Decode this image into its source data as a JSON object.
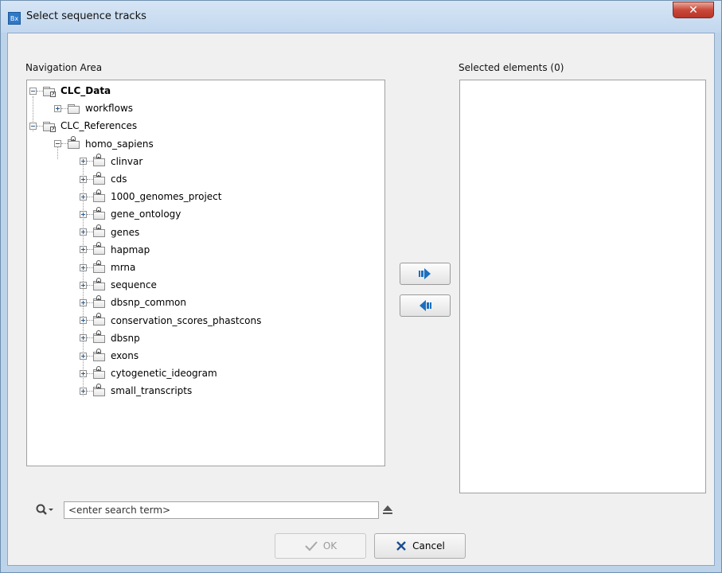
{
  "window": {
    "title": "Select sequence tracks",
    "app_icon_text": "Bx",
    "close_glyph": "✕"
  },
  "navigation_area": {
    "label": "Navigation Area",
    "tree": [
      {
        "label": "CLC_Data",
        "bold": true,
        "expanded": true,
        "icon": "linked-folder-icon"
      },
      {
        "label": "workflows",
        "icon": "folder-icon"
      },
      {
        "label": "CLC_References",
        "expanded": true,
        "icon": "linked-folder-icon"
      },
      {
        "label": "homo_sapiens",
        "expanded": true,
        "icon": "locked-folder-icon"
      },
      {
        "label": "clinvar"
      },
      {
        "label": "cds"
      },
      {
        "label": "1000_genomes_project"
      },
      {
        "label": "gene_ontology"
      },
      {
        "label": "genes"
      },
      {
        "label": "hapmap"
      },
      {
        "label": "mrna"
      },
      {
        "label": "sequence"
      },
      {
        "label": "dbsnp_common"
      },
      {
        "label": "conservation_scores_phastcons"
      },
      {
        "label": "dbsnp"
      },
      {
        "label": "exons"
      },
      {
        "label": "cytogenetic_ideogram"
      },
      {
        "label": "small_transcripts"
      }
    ]
  },
  "search": {
    "placeholder": "<enter search term>",
    "icon": "search-icon",
    "clear_icon": "eject-icon"
  },
  "selected": {
    "label": "Selected elements (0)",
    "count": 0
  },
  "buttons": {
    "ok_label": "OK",
    "cancel_label": "Cancel",
    "ok_enabled": false
  },
  "colors": {
    "accent": "#1c6fbf",
    "title_bar": "#c9dcf0",
    "close_button": "#c94a3c"
  }
}
